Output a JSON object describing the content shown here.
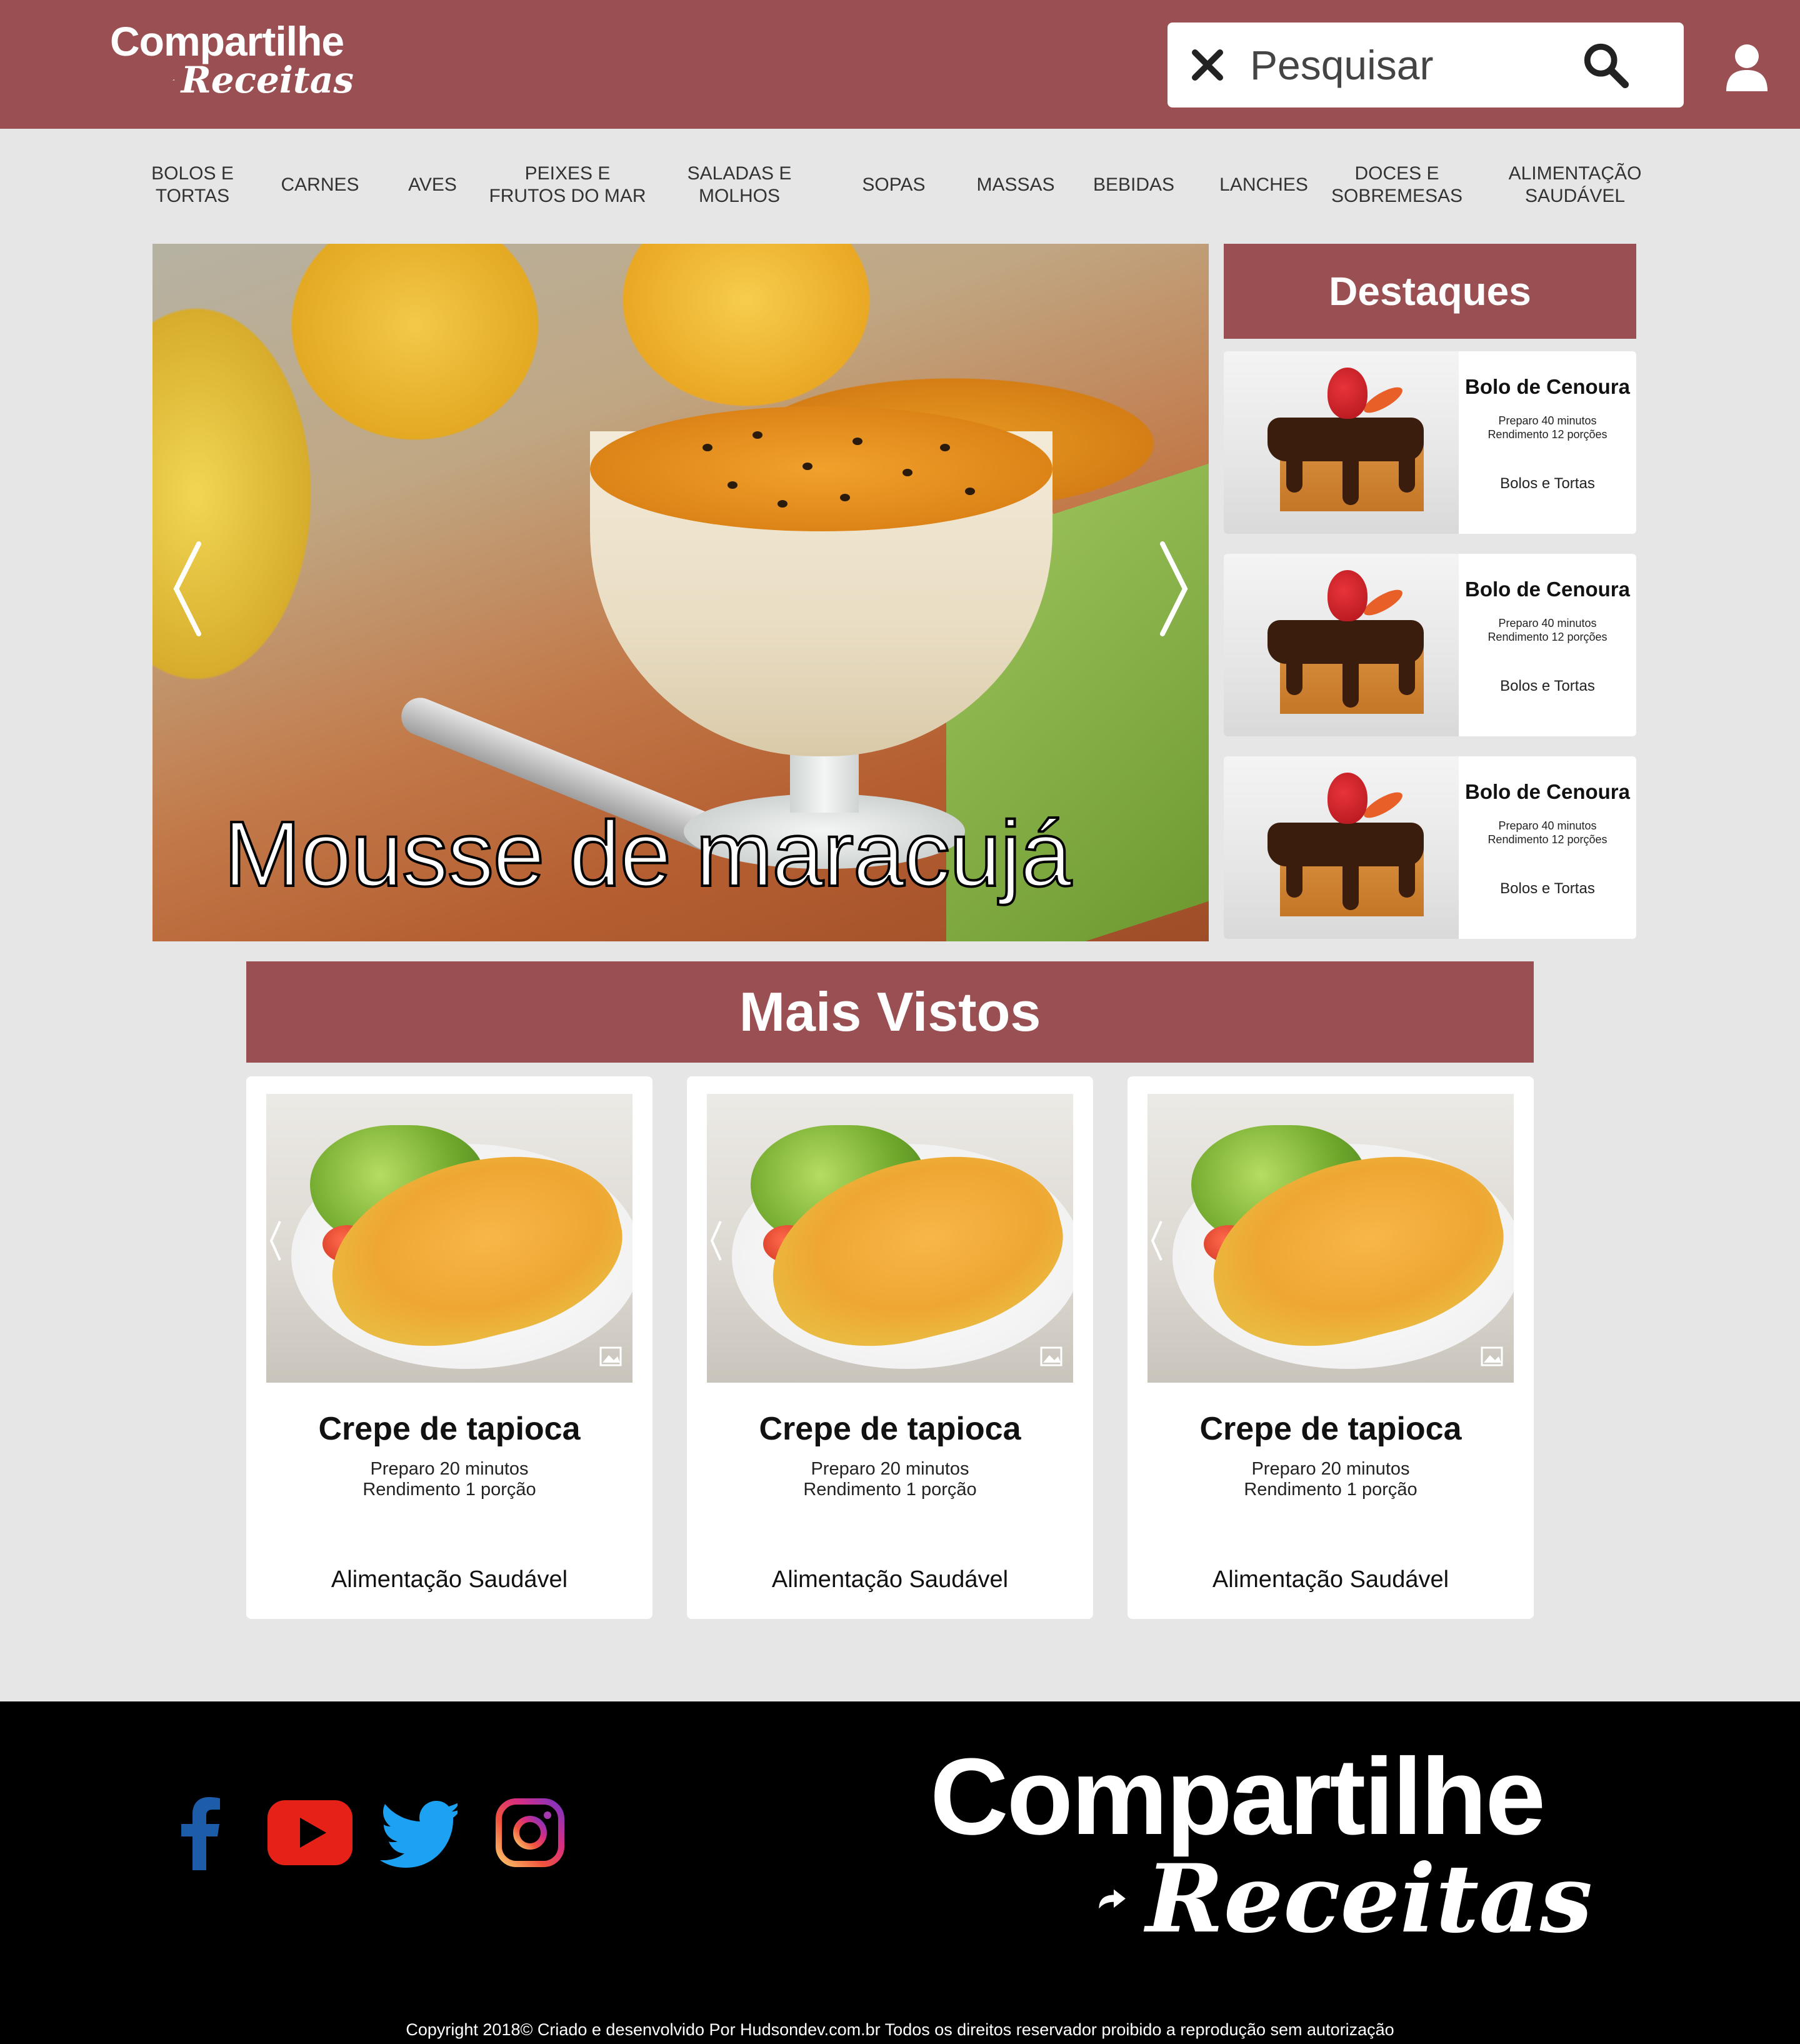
{
  "header": {
    "logo": {
      "line1": "Compartilhe",
      "line2": "Receitas"
    },
    "search": {
      "placeholder": "Pesquisar"
    }
  },
  "nav": [
    {
      "line1": "BOLOS E",
      "line2": "TORTAS"
    },
    {
      "line1": "CARNES",
      "line2": ""
    },
    {
      "line1": "AVES",
      "line2": ""
    },
    {
      "line1": "PEIXES E",
      "line2": "FRUTOS DO MAR"
    },
    {
      "line1": "SALADAS  E",
      "line2": "MOLHOS"
    },
    {
      "line1": "SOPAS",
      "line2": ""
    },
    {
      "line1": "MASSAS",
      "line2": ""
    },
    {
      "line1": "BEBIDAS",
      "line2": ""
    },
    {
      "line1": "LANCHES",
      "line2": ""
    },
    {
      "line1": "DOCES E",
      "line2": "SOBREMESAS"
    },
    {
      "line1": "ALIMENTAÇÃO",
      "line2": "SAUDÁVEL"
    }
  ],
  "hero": {
    "title": "Mousse de maracujá"
  },
  "destaques": {
    "heading": "Destaques",
    "items": [
      {
        "title": "Bolo de Cenoura",
        "preparo": "Preparo 40 minutos",
        "rendimento": "Rendimento 12 porções",
        "category": "Bolos e Tortas"
      },
      {
        "title": "Bolo de Cenoura",
        "preparo": "Preparo 40 minutos",
        "rendimento": "Rendimento 12 porções",
        "category": "Bolos e Tortas"
      },
      {
        "title": "Bolo de Cenoura",
        "preparo": "Preparo 40 minutos",
        "rendimento": "Rendimento 12 porções",
        "category": "Bolos e Tortas"
      }
    ]
  },
  "mais_vistos": {
    "heading": "Mais Vistos",
    "items": [
      {
        "title": "Crepe de tapioca",
        "preparo": "Preparo 20 minutos",
        "rendimento": "Rendimento 1 porção",
        "category": "Alimentação Saudável"
      },
      {
        "title": "Crepe de tapioca",
        "preparo": "Preparo 20 minutos",
        "rendimento": "Rendimento 1 porção",
        "category": "Alimentação Saudável"
      },
      {
        "title": "Crepe de tapioca",
        "preparo": "Preparo 20 minutos",
        "rendimento": "Rendimento 1 porção",
        "category": "Alimentação Saudável"
      }
    ]
  },
  "footer": {
    "social_icons": [
      "facebook-icon",
      "youtube-icon",
      "twitter-icon",
      "instagram-icon"
    ],
    "logo": {
      "line1": "Compartilhe",
      "line2": "Receitas"
    },
    "copyright": "Copyright 2018© Criado e desenvolvido Por Hudsondev.com.br  Todos os direitos reservador proibido a reprodução sem autorização"
  },
  "colors": {
    "brand": "#9a4f52",
    "background": "#e6e6e6",
    "footer": "#000000",
    "facebook": "#1d5ca8",
    "youtube": "#e62117",
    "twitter": "#1da1f2"
  }
}
